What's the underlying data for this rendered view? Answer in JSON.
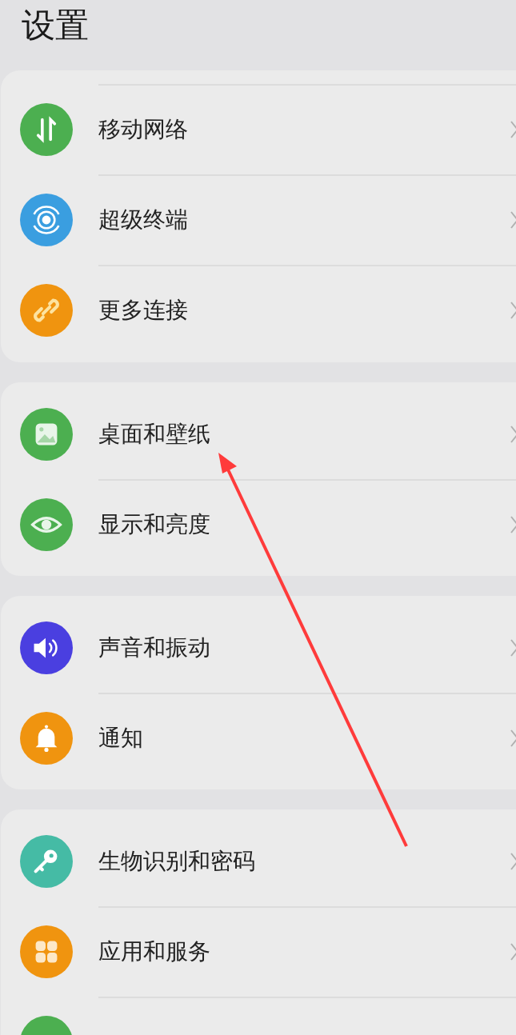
{
  "title": "设置",
  "groups": [
    {
      "items": [
        {
          "label": "移动网络",
          "color": "#4caf50"
        },
        {
          "label": "超级终端",
          "color": "#3a9ee0"
        },
        {
          "label": "更多连接",
          "color": "#f0940f"
        }
      ]
    },
    {
      "items": [
        {
          "label": "桌面和壁纸",
          "color": "#4caf50"
        },
        {
          "label": "显示和亮度",
          "color": "#4caf50"
        }
      ]
    },
    {
      "items": [
        {
          "label": "声音和振动",
          "color": "#4a3fe0"
        },
        {
          "label": "通知",
          "color": "#f0940f"
        }
      ]
    },
    {
      "items": [
        {
          "label": "生物识别和密码",
          "color": "#45bba5"
        },
        {
          "label": "应用和服务",
          "color": "#f0940f"
        },
        {
          "color": "#4caf50"
        }
      ]
    }
  ]
}
